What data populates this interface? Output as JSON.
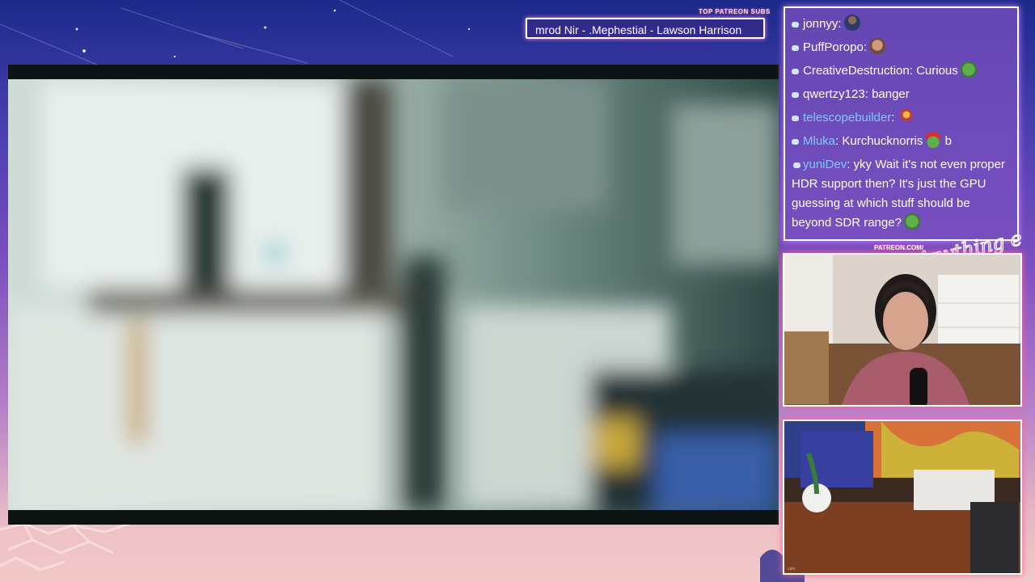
{
  "overlay": {
    "top_patreon_label": "TOP PATREON SUBS",
    "patreon_ticker": "mrod Nir - .Mephestial - Lawson Harrison",
    "patreon_url": "PATREON.COM/",
    "brand_logo": "Anything else?"
  },
  "chat": {
    "messages": [
      {
        "user": "jonnyy",
        "text": "",
        "emote": "person-emote",
        "user_color": "#ffffff"
      },
      {
        "user": "PuffPoropo",
        "text": "",
        "emote": "face-emote",
        "user_color": "#ffffff"
      },
      {
        "user": "CreativeDestruction",
        "text": "Curious",
        "emote": "pepe-emote",
        "user_color": "#ffffff"
      },
      {
        "user": "qwertzy123",
        "text": "banger",
        "emote": "",
        "user_color": "#ffffff"
      },
      {
        "user": "telescopebuilder",
        "text": "",
        "emote": "bird-emote",
        "user_color": "#7ec8ff"
      },
      {
        "user": "Mluka",
        "text": "Kurchucknorris",
        "text2": "b",
        "emote": "pepe-santa-emote",
        "user_color": "#7ec8ff"
      },
      {
        "user": "yuniDev",
        "text": "yky Wait it's not even proper HDR support then? It's just the GPU guessing at which stuff should be beyond SDR range?",
        "emote": "pepe-emote",
        "user_color": "#7ec8ff"
      }
    ]
  },
  "webcams": {
    "cam2_label": "cam"
  },
  "colors": {
    "chat_bg": "#7850be",
    "accent_pink": "#ff5fa0",
    "accent_cyan": "#55ffe6"
  }
}
